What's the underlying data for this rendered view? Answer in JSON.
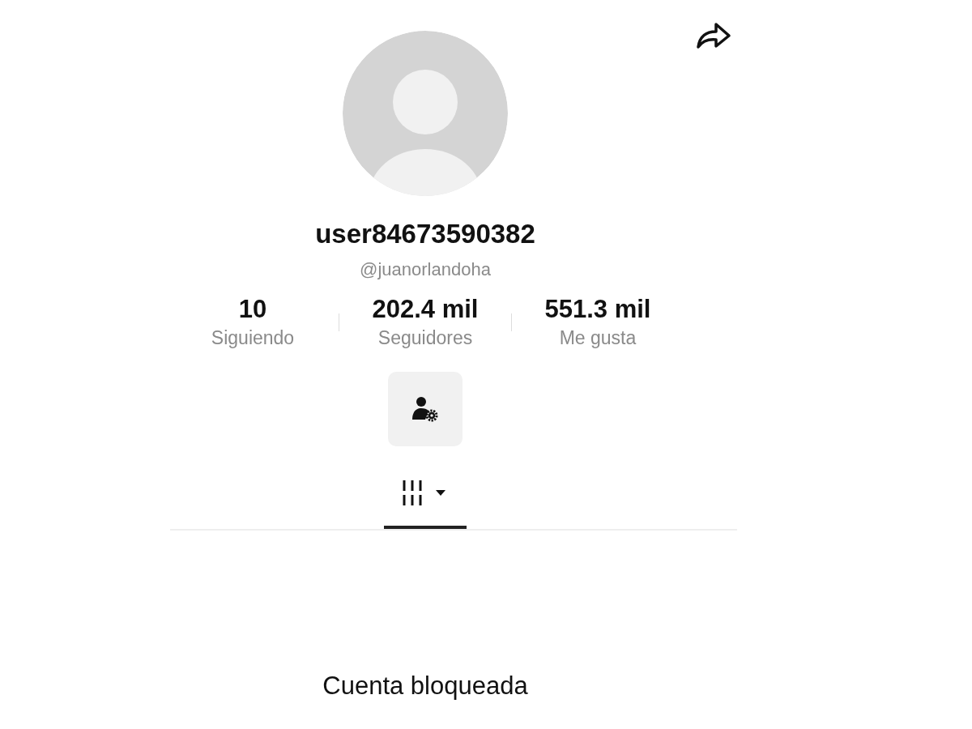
{
  "profile": {
    "username": "user84673590382",
    "handle": "@juanorlandoha"
  },
  "stats": [
    {
      "value": "10",
      "label": "Siguiendo"
    },
    {
      "value": "202.4 mil",
      "label": "Seguidores"
    },
    {
      "value": "551.3 mil",
      "label": "Me gusta"
    }
  ],
  "tabs": [
    {
      "selected": true
    }
  ],
  "message": "Cuenta bloqueada"
}
